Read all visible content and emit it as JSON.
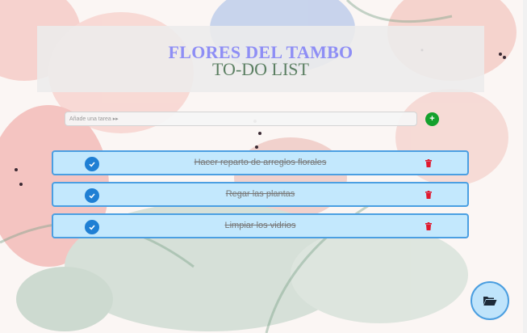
{
  "header": {
    "title": "FLORES DEL TAMBO",
    "subtitle": "TO-DO LIST"
  },
  "new_task": {
    "placeholder": "Añade una tarea ▸▸",
    "add_icon": "plus-icon"
  },
  "tasks": [
    {
      "label": "Hacer reparto de arreglos florales",
      "done": true
    },
    {
      "label": "Regar las plantas",
      "done": true
    },
    {
      "label": "Limpiar los vidrios",
      "done": true
    }
  ],
  "colors": {
    "title": "#8e8ef5",
    "subtitle": "#5b7f62",
    "task_bg": "#c3e8fd",
    "task_border": "#4b9fe2",
    "check": "#1f7fd4",
    "add": "#14a12d",
    "delete": "#e0182d"
  },
  "fab": {
    "icon": "folder-open-icon"
  }
}
